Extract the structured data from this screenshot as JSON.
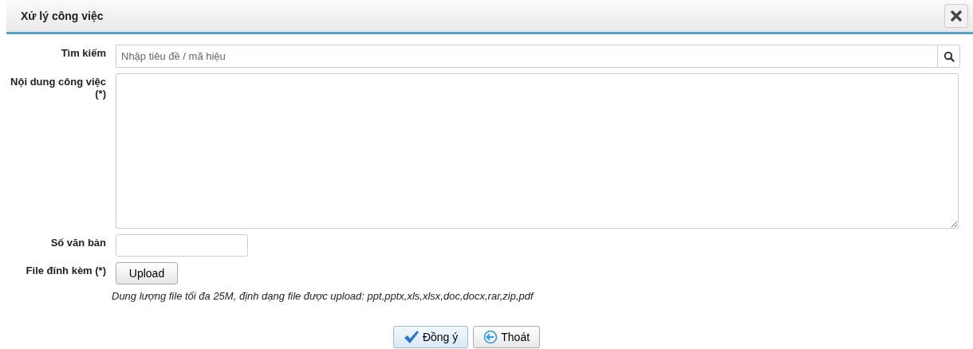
{
  "window": {
    "title": "Xử lý công việc"
  },
  "form": {
    "search": {
      "label": "Tìm kiếm",
      "placeholder": "Nhập tiêu đề / mã hiệu"
    },
    "content": {
      "label": "Nội dung công việc (*)"
    },
    "doc_number": {
      "label": "Số văn bản"
    },
    "attachment": {
      "label": "File đính kèm (*)",
      "button": "Upload",
      "hint": "Dung lượng file tối đa 25M, định dạng file được upload: ppt,pptx,xls,xlsx,doc,docx,rar,zip,pdf"
    }
  },
  "buttons": [
    {
      "label": "Đồng ý",
      "kind": "confirm",
      "selected": true
    },
    {
      "label": "Thoát",
      "kind": "exit",
      "selected": false
    }
  ]
}
